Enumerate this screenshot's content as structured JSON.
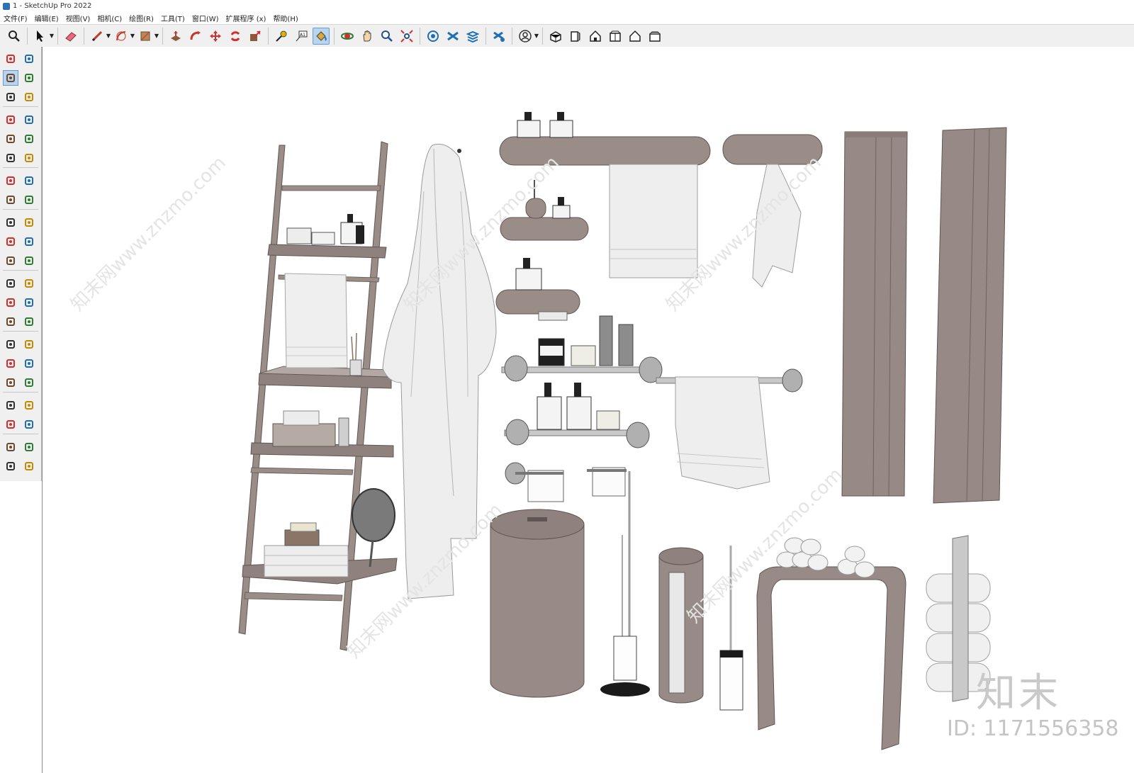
{
  "window": {
    "title": "1 - SketchUp Pro 2022"
  },
  "menu": [
    {
      "label": "文件(F)"
    },
    {
      "label": "编辑(E)"
    },
    {
      "label": "视图(V)"
    },
    {
      "label": "相机(C)"
    },
    {
      "label": "绘图(R)"
    },
    {
      "label": "工具(T)"
    },
    {
      "label": "窗口(W)"
    },
    {
      "label": "扩展程序 (x)"
    },
    {
      "label": "帮助(H)"
    }
  ],
  "toolbar": {
    "buttons": [
      {
        "icon": "zoom-icon"
      },
      {
        "icon": "select-icon",
        "dropdown": true
      },
      {
        "icon": "eraser-icon"
      },
      {
        "icon": "pencil-icon",
        "dropdown": true
      },
      {
        "icon": "arc-icon",
        "dropdown": true
      },
      {
        "icon": "rectangle-icon",
        "dropdown": true
      },
      {
        "icon": "push-pull-icon"
      },
      {
        "icon": "follow-me-icon"
      },
      {
        "icon": "move-icon"
      },
      {
        "icon": "rotate-icon"
      },
      {
        "icon": "scale-icon"
      },
      {
        "icon": "tape-measure-icon"
      },
      {
        "icon": "text-icon"
      },
      {
        "icon": "paint-bucket-icon",
        "active": true
      },
      {
        "icon": "orbit-icon"
      },
      {
        "icon": "pan-icon"
      },
      {
        "icon": "zoom-window-icon"
      },
      {
        "icon": "zoom-extents-icon"
      },
      {
        "icon": "warehouse-icon"
      },
      {
        "icon": "extension-icon"
      },
      {
        "icon": "layers-icon"
      },
      {
        "icon": "extension-manager-icon"
      },
      {
        "icon": "account-icon",
        "dropdown": true
      },
      {
        "icon": "iso-view-icon"
      },
      {
        "icon": "front-view-icon"
      },
      {
        "icon": "top-view-icon"
      },
      {
        "icon": "right-view-icon"
      },
      {
        "icon": "back-view-icon"
      },
      {
        "icon": "left-view-icon"
      }
    ]
  },
  "lefttoolbar": {
    "tools": [
      "select-icon",
      "orbit-icon",
      "paint-bucket-icon",
      "eraser-icon",
      "component-icon",
      "tag-icon",
      "pencil-icon",
      "freehand-icon",
      "rectangle-icon",
      "rotated-rectangle-icon",
      "circle-icon",
      "polygon-icon",
      "arc-icon",
      "two-point-arc-icon",
      "three-point-arc-icon",
      "pie-icon",
      "move-icon",
      "push-pull-icon",
      "rotate-icon",
      "follow-me-icon",
      "scale-icon",
      "offset-icon",
      "tape-measure-icon",
      "dimension-icon",
      "protractor-icon",
      "text-icon",
      "axes-icon",
      "3d-text-icon",
      "orbit2-icon",
      "pan-icon",
      "zoom-icon",
      "zoom-window-icon",
      "zoom-extents-icon",
      "previous-view-icon",
      "position-camera-icon",
      "look-around-icon",
      "walk-icon",
      "section-plane-icon",
      "warehouse-icon",
      "extension-icon",
      "layers-icon",
      "extension-manager-icon"
    ],
    "active_index": 2
  },
  "viewport": {
    "watermark_text": "知末网www.znzmo.com",
    "brand": "知末",
    "image_id": "ID: 1171556358"
  },
  "colors": {
    "taupe": "#978a86",
    "taupe_dark": "#6e6360",
    "towel": "#efefef",
    "chrome": "#b9b9b9"
  }
}
